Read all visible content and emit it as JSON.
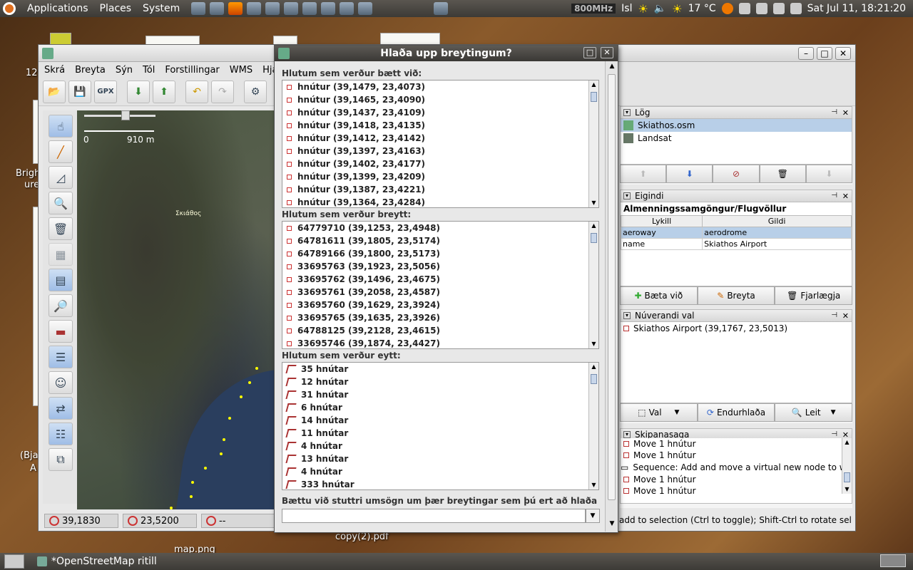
{
  "top_panel": {
    "menus": [
      "Applications",
      "Places",
      "System"
    ],
    "cpu": "800MHz",
    "keyboard": "Isl",
    "temperature": "17 °C",
    "datetime": "Sat Jul 11, 18:21:20"
  },
  "bottom_panel": {
    "task": "*OpenStreetMap ritill"
  },
  "desktop": {
    "labels": [
      "12",
      "Brigh",
      "ure",
      "(Bja",
      "A",
      "map.png",
      "copy(2).pdf"
    ]
  },
  "josm": {
    "menu": [
      "Skrá",
      "Breyta",
      "Sýn",
      "Tól",
      "Forstillingar",
      "WMS",
      "Hjálp"
    ],
    "gpx_label": "GPX",
    "scale_zero": "0",
    "scale_distance": "910 m",
    "place_name": "Σκιάθος",
    "status": {
      "lat": "39,1830",
      "lon": "23,5200",
      "heading": "--",
      "message": "add to selection (Ctrl to toggle); Shift-Ctrl to rotate selec"
    },
    "layers": {
      "title": "Lög",
      "items": [
        "Skiathos.osm",
        "Landsat"
      ]
    },
    "properties": {
      "title": "Eigindi",
      "preset": "Almenningssamgöngur/Flugvöllur",
      "col_key": "Lykill",
      "col_value": "Gildi",
      "rows": [
        {
          "key": "aeroway",
          "value": "aerodrome"
        },
        {
          "key": "name",
          "value": "Skiathos Airport"
        }
      ],
      "add": "Bæta við",
      "edit": "Breyta",
      "delete": "Fjarlægja"
    },
    "selection": {
      "title": "Núverandi val",
      "item": "Skiathos Airport (39,1767, 23,5013)",
      "select": "Val",
      "reload": "Endurhlaða",
      "search": "Leit"
    },
    "history": {
      "title": "Skipanasaga",
      "items": [
        "Move 1 hnútur",
        "Move 1 hnútur",
        "Sequence: Add and move a virtual new node to wa",
        "Move 1 hnútur",
        "Move 1 hnútur"
      ]
    }
  },
  "dialog": {
    "title": "Hlaða upp breytingum?",
    "added_label": "Hlutum sem verður bætt við:",
    "added": [
      "hnútur (39,1479, 23,4073)",
      "hnútur (39,1465, 23,4090)",
      "hnútur (39,1437, 23,4109)",
      "hnútur (39,1418, 23,4135)",
      "hnútur (39,1412, 23,4142)",
      "hnútur (39,1397, 23,4163)",
      "hnútur (39,1402, 23,4177)",
      "hnútur (39,1399, 23,4209)",
      "hnútur (39,1387, 23,4221)",
      "hnútur (39,1364, 23,4284)"
    ],
    "modified_label": "Hlutum sem verður breytt:",
    "modified": [
      "64779710 (39,1253, 23,4948)",
      "64781611 (39,1805, 23,5174)",
      "64789166 (39,1800, 23,5173)",
      "33695763 (39,1923, 23,5056)",
      "33695762 (39,1496, 23,4675)",
      "33695761 (39,2058, 23,4587)",
      "33695760 (39,1629, 23,3924)",
      "33695765 (39,1635, 23,3926)",
      "64788125 (39,2128, 23,4615)",
      "33695746 (39,1874, 23,4427)"
    ],
    "deleted_label": "Hlutum sem verður eytt:",
    "deleted": [
      "35 hnútar",
      "12 hnútar",
      "31 hnútar",
      "6 hnútar",
      "14 hnútar",
      "11 hnútar",
      "4 hnútar",
      "13 hnútar",
      "4 hnútar",
      "333 hnútar"
    ],
    "comment_label": "Bættu við stuttri umsögn um þær breytingar sem þú ert að hlaða upp:",
    "comment_value": ""
  }
}
